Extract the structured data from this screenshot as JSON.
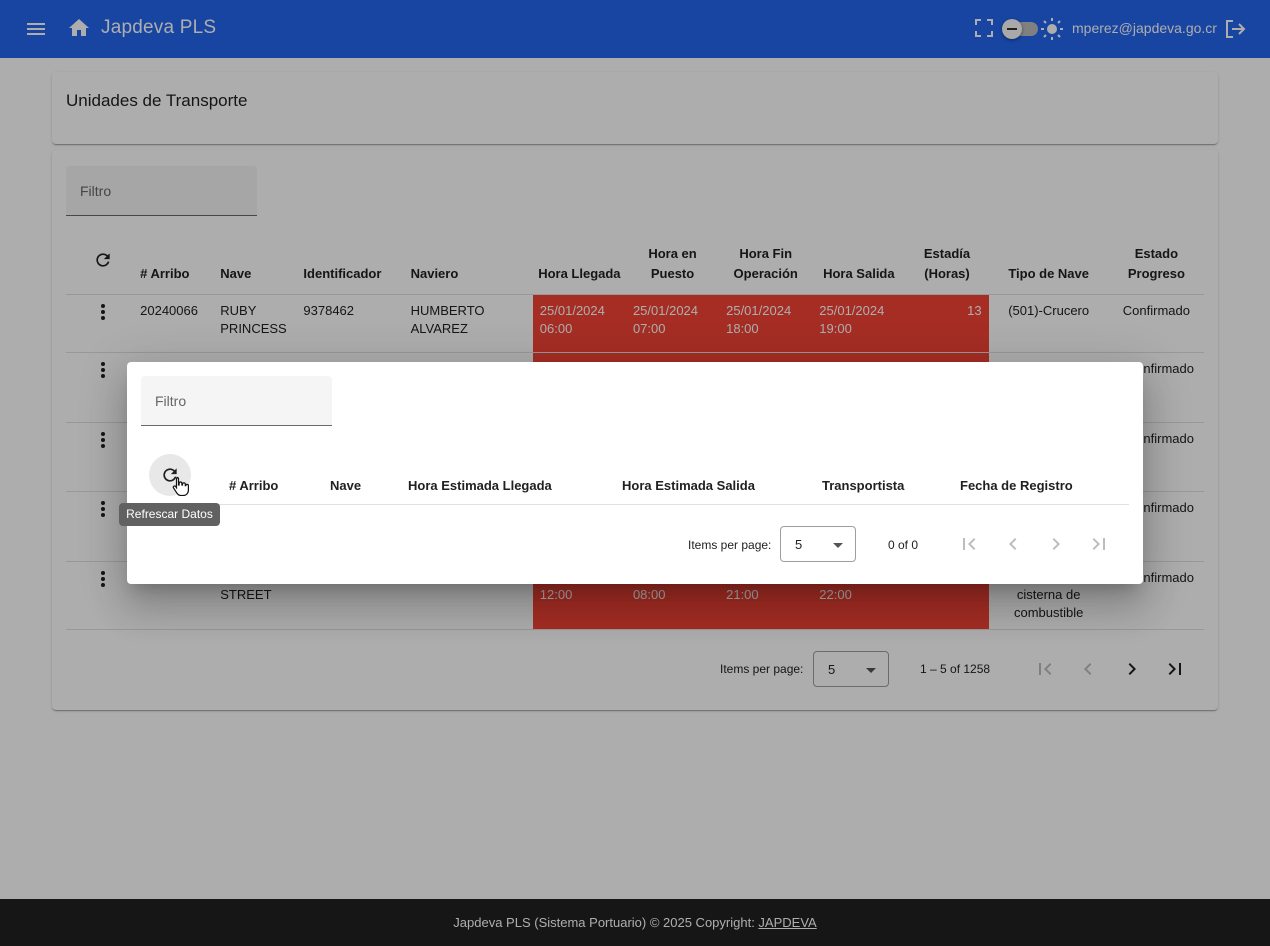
{
  "app": {
    "title": "Japdeva PLS",
    "user_email": "mperez@japdeva.go.cr"
  },
  "page": {
    "title": "Unidades de Transporte",
    "filter_placeholder": "Filtro"
  },
  "table": {
    "columns": {
      "arribo": "# Arribo",
      "nave": "Nave",
      "identificador": "Identificador",
      "naviero": "Naviero",
      "hora_llegada": "Hora Llegada",
      "hora_puesto": "Hora en Puesto",
      "hora_fin": "Hora Fin Operación",
      "hora_salida": "Hora Salida",
      "estadia": "Estadía (Horas)",
      "tipo_nave": "Tipo de Nave",
      "estado": "Estado Progreso"
    },
    "rows": [
      {
        "arribo": "20240066",
        "nave": "RUBY PRINCESS",
        "identificador": "9378462",
        "naviero": "HUMBERTO ALVAREZ",
        "hora_llegada": "25/01/2024 06:00",
        "hora_puesto": "25/01/2024 07:00",
        "hora_fin": "25/01/2024 18:00",
        "hora_salida": "25/01/2024 19:00",
        "estadia": "13",
        "tipo_nave": "(501)-Crucero",
        "estado": "Confirmado"
      },
      {
        "estado": "nfirmado"
      },
      {
        "estado": "nfirmado"
      },
      {
        "estado": "nfirmado"
      },
      {
        "nave": "STREET",
        "hora_llegada": "12:00",
        "hora_puesto": "08:00",
        "hora_fin": "21:00",
        "hora_salida": "22:00",
        "tipo_nave": "cisterna de combustible",
        "estado": "nfirmado"
      }
    ]
  },
  "paginator": {
    "items_per_page_label": "Items per page:",
    "page_size": "5",
    "range": "1 – 5 of 1258"
  },
  "dialog": {
    "filter_placeholder": "Filtro",
    "refresh_tooltip": "Refrescar Datos",
    "columns": {
      "arribo": "# Arribo",
      "nave": "Nave",
      "hora_estimada_llegada": "Hora Estimada Llegada",
      "hora_estimada_salida": "Hora Estimada Salida",
      "transportista": "Transportista",
      "fecha_registro": "Fecha de Registro"
    },
    "paginator": {
      "items_per_page_label": "Items per page:",
      "page_size": "5",
      "range": "0 of 0"
    }
  },
  "footer": {
    "text": "Japdeva PLS (Sistema Portuario) © 2025 Copyright: ",
    "link": "JAPDEVA"
  },
  "colors": {
    "toolbar": "#2266ee",
    "highlight_red": "#f44336",
    "footer": "#212121"
  }
}
